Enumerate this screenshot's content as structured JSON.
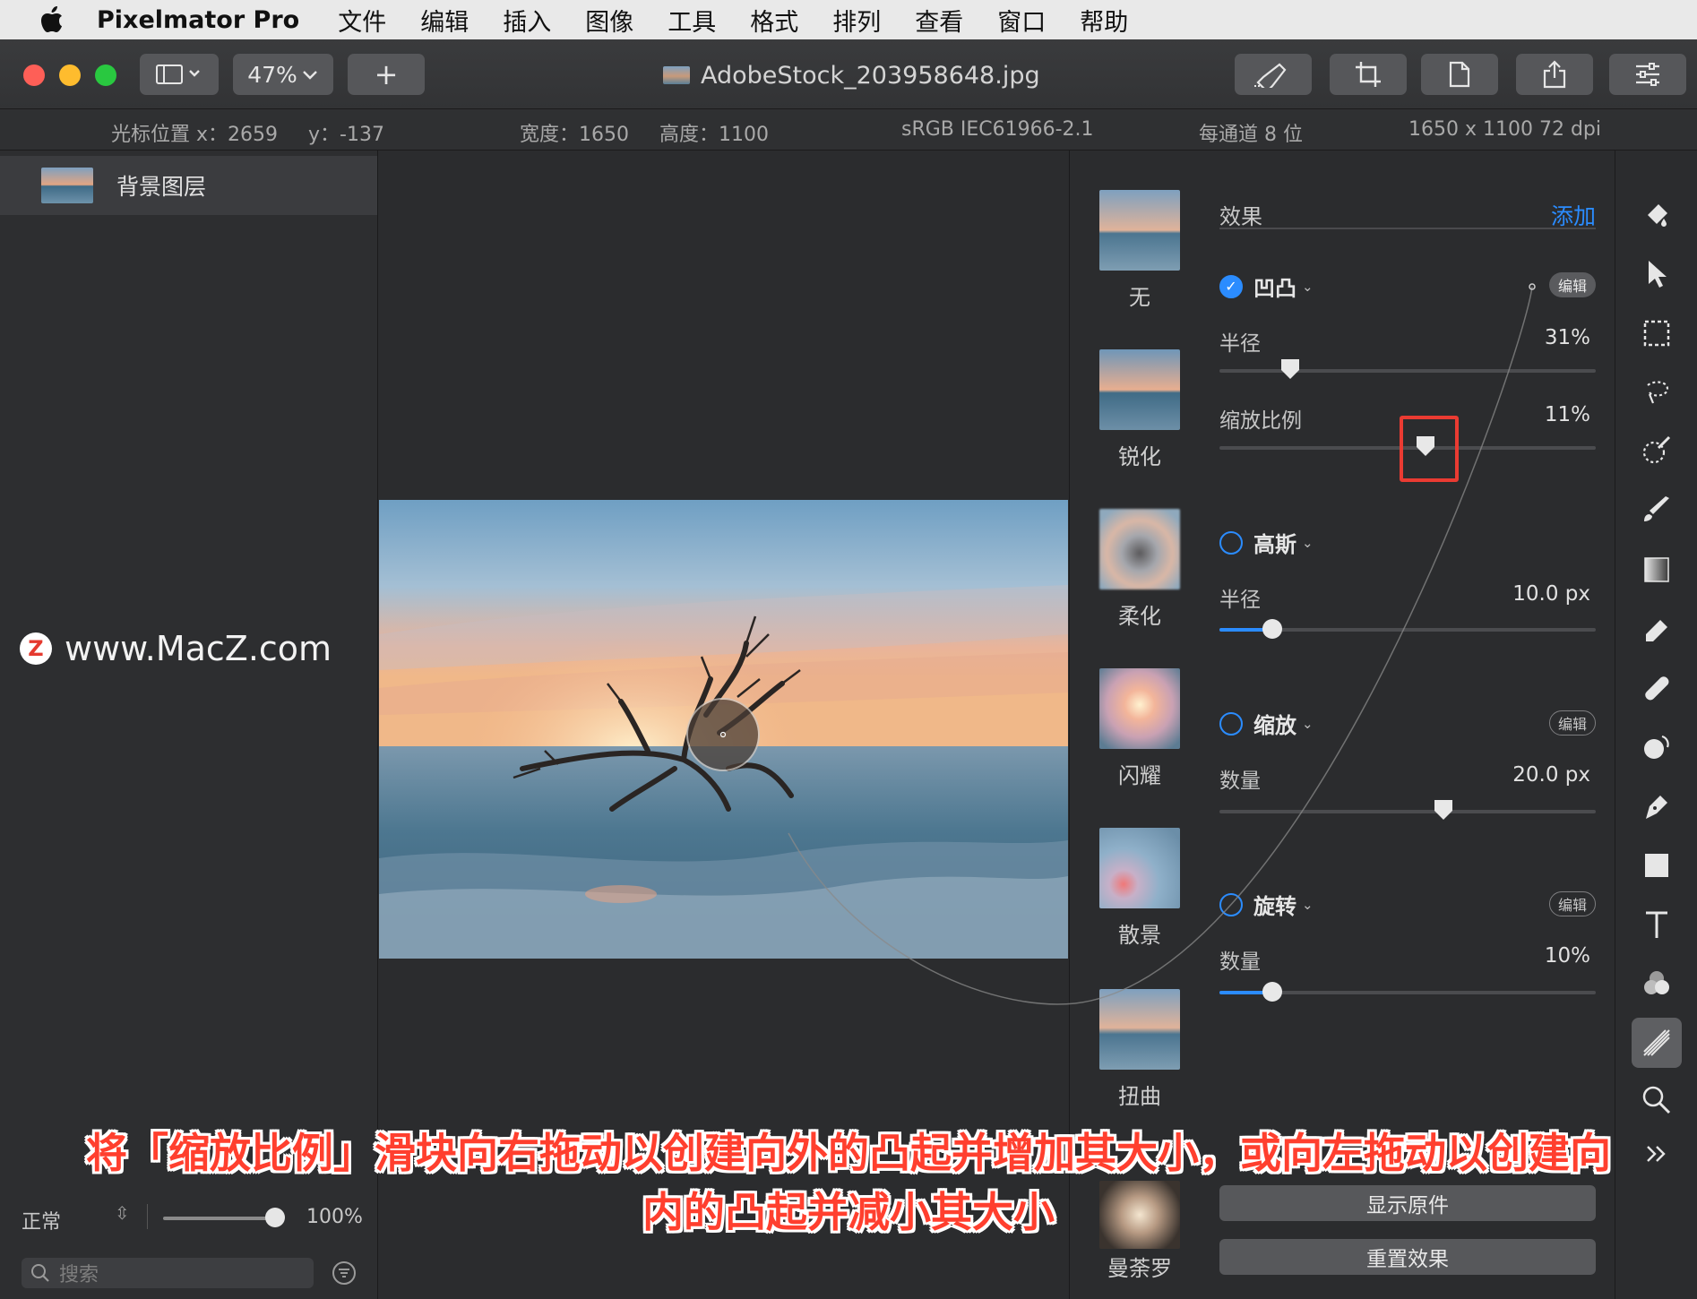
{
  "menubar": {
    "app_name": "Pixelmator Pro",
    "items": [
      "文件",
      "编辑",
      "插入",
      "图像",
      "工具",
      "格式",
      "排列",
      "查看",
      "窗口",
      "帮助"
    ]
  },
  "toolbar": {
    "zoom": "47%",
    "add_label": "+",
    "document_title": "AdobeStock_203958648.jpg"
  },
  "infobar": {
    "cursor_x": "光标位置 x：2659",
    "cursor_y": "y：-137",
    "width": "宽度：1650",
    "height": "高度：1100",
    "color_profile": "sRGB IEC61966-2.1",
    "bit_depth": "每通道 8 位",
    "dimensions": "1650 x 1100 72 dpi"
  },
  "layers": {
    "items": [
      {
        "name": "背景图层"
      }
    ],
    "blend_mode": "正常",
    "opacity": "100%",
    "opacity_fraction": 1.0,
    "search_placeholder": "搜索"
  },
  "watermark": "www.MacZ.com",
  "browser": {
    "items": [
      "无",
      "锐化",
      "柔化",
      "闪耀",
      "散景",
      "扭曲",
      "曼荼罗"
    ]
  },
  "effects": {
    "header": "效果",
    "add_label": "添加",
    "edit_label": "编辑",
    "blocks": [
      {
        "title": "凹凸",
        "enabled": true,
        "param_label": "半径",
        "param_value": "31%",
        "fraction": 0.17,
        "param2_label": "缩放比例",
        "param2_value": "11%",
        "fraction2": 0.55
      },
      {
        "title": "高斯",
        "enabled": false,
        "param_label": "半径",
        "param_value": "10.0 px",
        "fraction": 0.12
      },
      {
        "title": "缩放",
        "enabled": false,
        "param_label": "数量",
        "param_value": "20.0 px",
        "fraction": 0.6
      },
      {
        "title": "旋转",
        "enabled": false,
        "param_label": "数量",
        "param_value": "10%",
        "fraction": 0.12
      }
    ],
    "show_original": "显示原件",
    "reset_effects": "重置效果"
  },
  "caption": {
    "line1": "将「缩放比例」滑块向右拖动以创建向外的凸起并增加其大小，或向左拖动以创建向",
    "line2": "内的凸起并减小其大小"
  },
  "colors": {
    "accent": "#2b8cff",
    "highlight": "#ea3b32",
    "caption": "#ff3f2e"
  }
}
